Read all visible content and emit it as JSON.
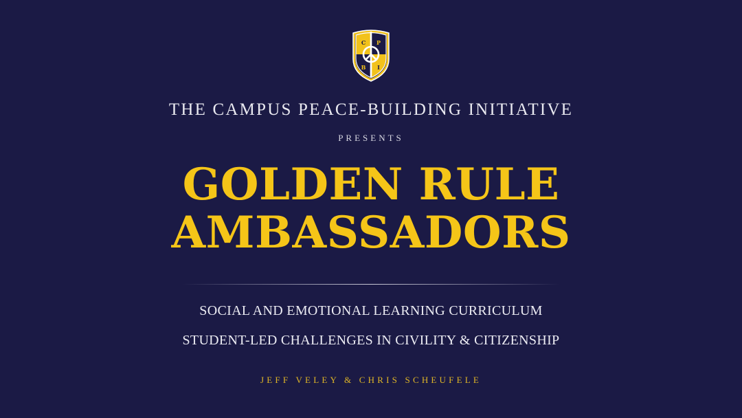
{
  "crest": {
    "letters": [
      "C",
      "P",
      "B",
      "I"
    ]
  },
  "org_name": "THE CAMPUS PEACE-BUILDING INITIATIVE",
  "presents": "PRESENTS",
  "title": {
    "line1": "GOLDEN RULE",
    "line2": "AMBASSADORS"
  },
  "subtitles": [
    "SOCIAL AND EMOTIONAL LEARNING CURRICULUM",
    "STUDENT-LED CHALLENGES IN CIVILITY & CITIZENSHIP"
  ],
  "authors": "JEFF VELEY & CHRIS SCHEUFELE",
  "colors": {
    "background": "#1b1a45",
    "gold": "#f5c518",
    "text": "#e9e9f0"
  }
}
